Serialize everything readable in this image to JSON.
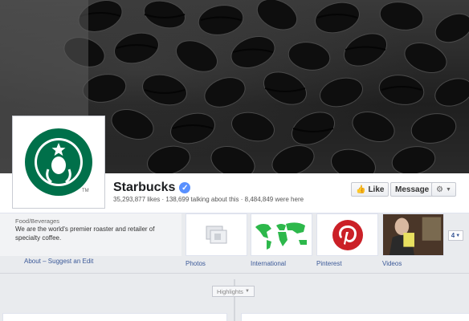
{
  "page": {
    "name": "Starbucks",
    "stats": "35,293,877 likes · 138,699 talking about this · 8,484,849 were here"
  },
  "actions": {
    "like_label": "Like",
    "message_label": "Message"
  },
  "about": {
    "category": "Food/Beverages",
    "description": "We are the world's premier roaster and retailer of specialty coffee.",
    "link": "About – Suggest an Edit"
  },
  "apps": [
    {
      "label": "Photos",
      "icon": "photos-icon"
    },
    {
      "label": "International",
      "icon": "world-map-icon"
    },
    {
      "label": "Pinterest",
      "icon": "pinterest-icon"
    },
    {
      "label": "Videos",
      "icon": "video-thumbnail"
    }
  ],
  "more_count": "4",
  "timeline": {
    "highlights_label": "Highlights"
  },
  "colors": {
    "starbucks_green": "#00704a",
    "facebook_blue": "#3b5998",
    "verified_blue": "#5890ff",
    "pinterest_red": "#cb2027",
    "map_green": "#2db84b"
  }
}
